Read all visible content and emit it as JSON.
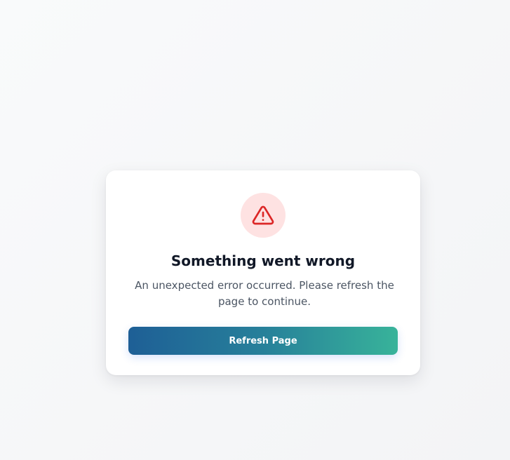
{
  "error": {
    "icon": "warning-triangle-icon",
    "icon_color": "#dc2626",
    "icon_bg": "#fee2e2",
    "title": "Something went wrong",
    "message": "An unexpected error occurred. Please refresh the page to continue.",
    "button_label": "Refresh Page",
    "button_gradient_start": "#1e5f96",
    "button_gradient_end": "#38b39a"
  }
}
